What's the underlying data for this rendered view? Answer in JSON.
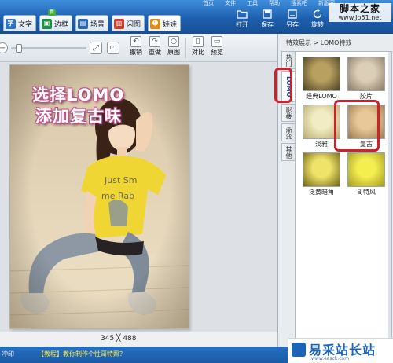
{
  "top_menu": [
    "首页",
    "文件",
    "工具",
    "帮助",
    "搜素吧",
    "新版网"
  ],
  "tabs": [
    {
      "icon": "text-icon",
      "glyph": "字",
      "color": "#2d74c9",
      "label": "文字"
    },
    {
      "icon": "border-icon",
      "glyph": "▣",
      "color": "#1c8f43",
      "label": "边框",
      "badge": "新"
    },
    {
      "icon": "scene-icon",
      "glyph": "▤",
      "color": "#2b68b1",
      "label": "场景"
    },
    {
      "icon": "flash-icon",
      "glyph": "▥",
      "color": "#d53a2a",
      "label": "闪图"
    },
    {
      "icon": "doll-icon",
      "glyph": "☻",
      "color": "#e08a10",
      "label": "娃娃"
    }
  ],
  "actions": [
    {
      "icon": "open-icon",
      "label": "打开"
    },
    {
      "icon": "save-icon",
      "label": "保存"
    },
    {
      "icon": "save-as-icon",
      "label": "另存"
    },
    {
      "icon": "rotate-icon",
      "label": "旋转"
    }
  ],
  "watermark_top": {
    "title": "脚本之家",
    "url": "www.Jb51.net"
  },
  "edit_tools": [
    {
      "icon": "undo-icon",
      "glyph": "↶",
      "label": "撤销"
    },
    {
      "icon": "redo-icon",
      "glyph": "↷",
      "label": "重做"
    },
    {
      "icon": "original-icon",
      "glyph": "○",
      "label": "原图"
    },
    {
      "icon": "compare-icon",
      "glyph": "▯",
      "label": "对比"
    },
    {
      "icon": "preview-icon",
      "glyph": "▭",
      "label": "预览"
    }
  ],
  "photo_overlay": {
    "line1": "选择LOMO",
    "line2": "添加复古味"
  },
  "canvas_dimensions": "345 ╳ 488",
  "breadcrumb": "特效展示 > LOMO特效",
  "vertical_tabs": [
    {
      "label": "热门",
      "active": false
    },
    {
      "label": "LOMO",
      "active": true
    },
    {
      "label": "影楼",
      "active": false
    },
    {
      "label": "渐变",
      "active": false
    },
    {
      "label": "其他",
      "active": false
    }
  ],
  "effects": [
    {
      "label": "经典LOMO",
      "tone_a": "#b8a060",
      "tone_b": "#4d3f22",
      "selected": false
    },
    {
      "label": "胶片",
      "tone_a": "#dccfb8",
      "tone_b": "#8b7a62",
      "selected": false
    },
    {
      "label": "淡雅",
      "tone_a": "#f1ecc3",
      "tone_b": "#b8ab74",
      "selected": false
    },
    {
      "label": "复古",
      "tone_a": "#e8c898",
      "tone_b": "#9c7a52",
      "selected": true
    },
    {
      "label": "泛黄暗角",
      "tone_a": "#f0e36a",
      "tone_b": "#6e6416",
      "selected": false
    },
    {
      "label": "哥特风",
      "tone_a": "#f4ee50",
      "tone_b": "#a39a22",
      "selected": false
    }
  ],
  "status_left": "冲印",
  "tutorial_link": "【教程】教你制作个性哥特照？",
  "watermark_bottom": {
    "title": "易采站长站",
    "url": "www.easck.com"
  }
}
